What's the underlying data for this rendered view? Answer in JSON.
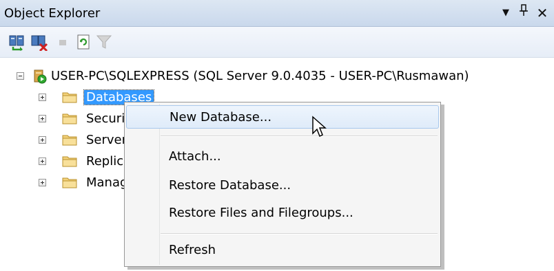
{
  "window": {
    "title": "Object Explorer",
    "dropdown_glyph": "▾",
    "pin_glyph": "ꟷ",
    "close_glyph": "×"
  },
  "toolbar": {
    "buttons": [
      {
        "name": "connect",
        "icon": "connect-icon"
      },
      {
        "name": "disconnect",
        "icon": "disconnect-icon"
      },
      {
        "name": "stop",
        "icon": "stop-icon",
        "disabled": true
      },
      {
        "name": "refresh",
        "icon": "refresh-icon"
      },
      {
        "name": "filter",
        "icon": "filter-icon",
        "disabled": true
      }
    ]
  },
  "tree": {
    "server": "USER-PC\\SQLEXPRESS (SQL Server 9.0.4035 - USER-PC\\Rusmawan)",
    "nodes": [
      {
        "label": "Databases",
        "selected": true
      },
      {
        "label": "Security"
      },
      {
        "label": "Server Objects"
      },
      {
        "label": "Replication"
      },
      {
        "label": "Management"
      }
    ]
  },
  "context_menu": {
    "items": [
      "New Database...",
      "Attach...",
      "Restore Database...",
      "Restore Files and Filegroups...",
      "Refresh"
    ],
    "hovered": "New Database..."
  },
  "colors": {
    "selection": "#3399ff",
    "titlebar": "#cfdcee",
    "menu_hover_border": "#a8c8ed"
  }
}
